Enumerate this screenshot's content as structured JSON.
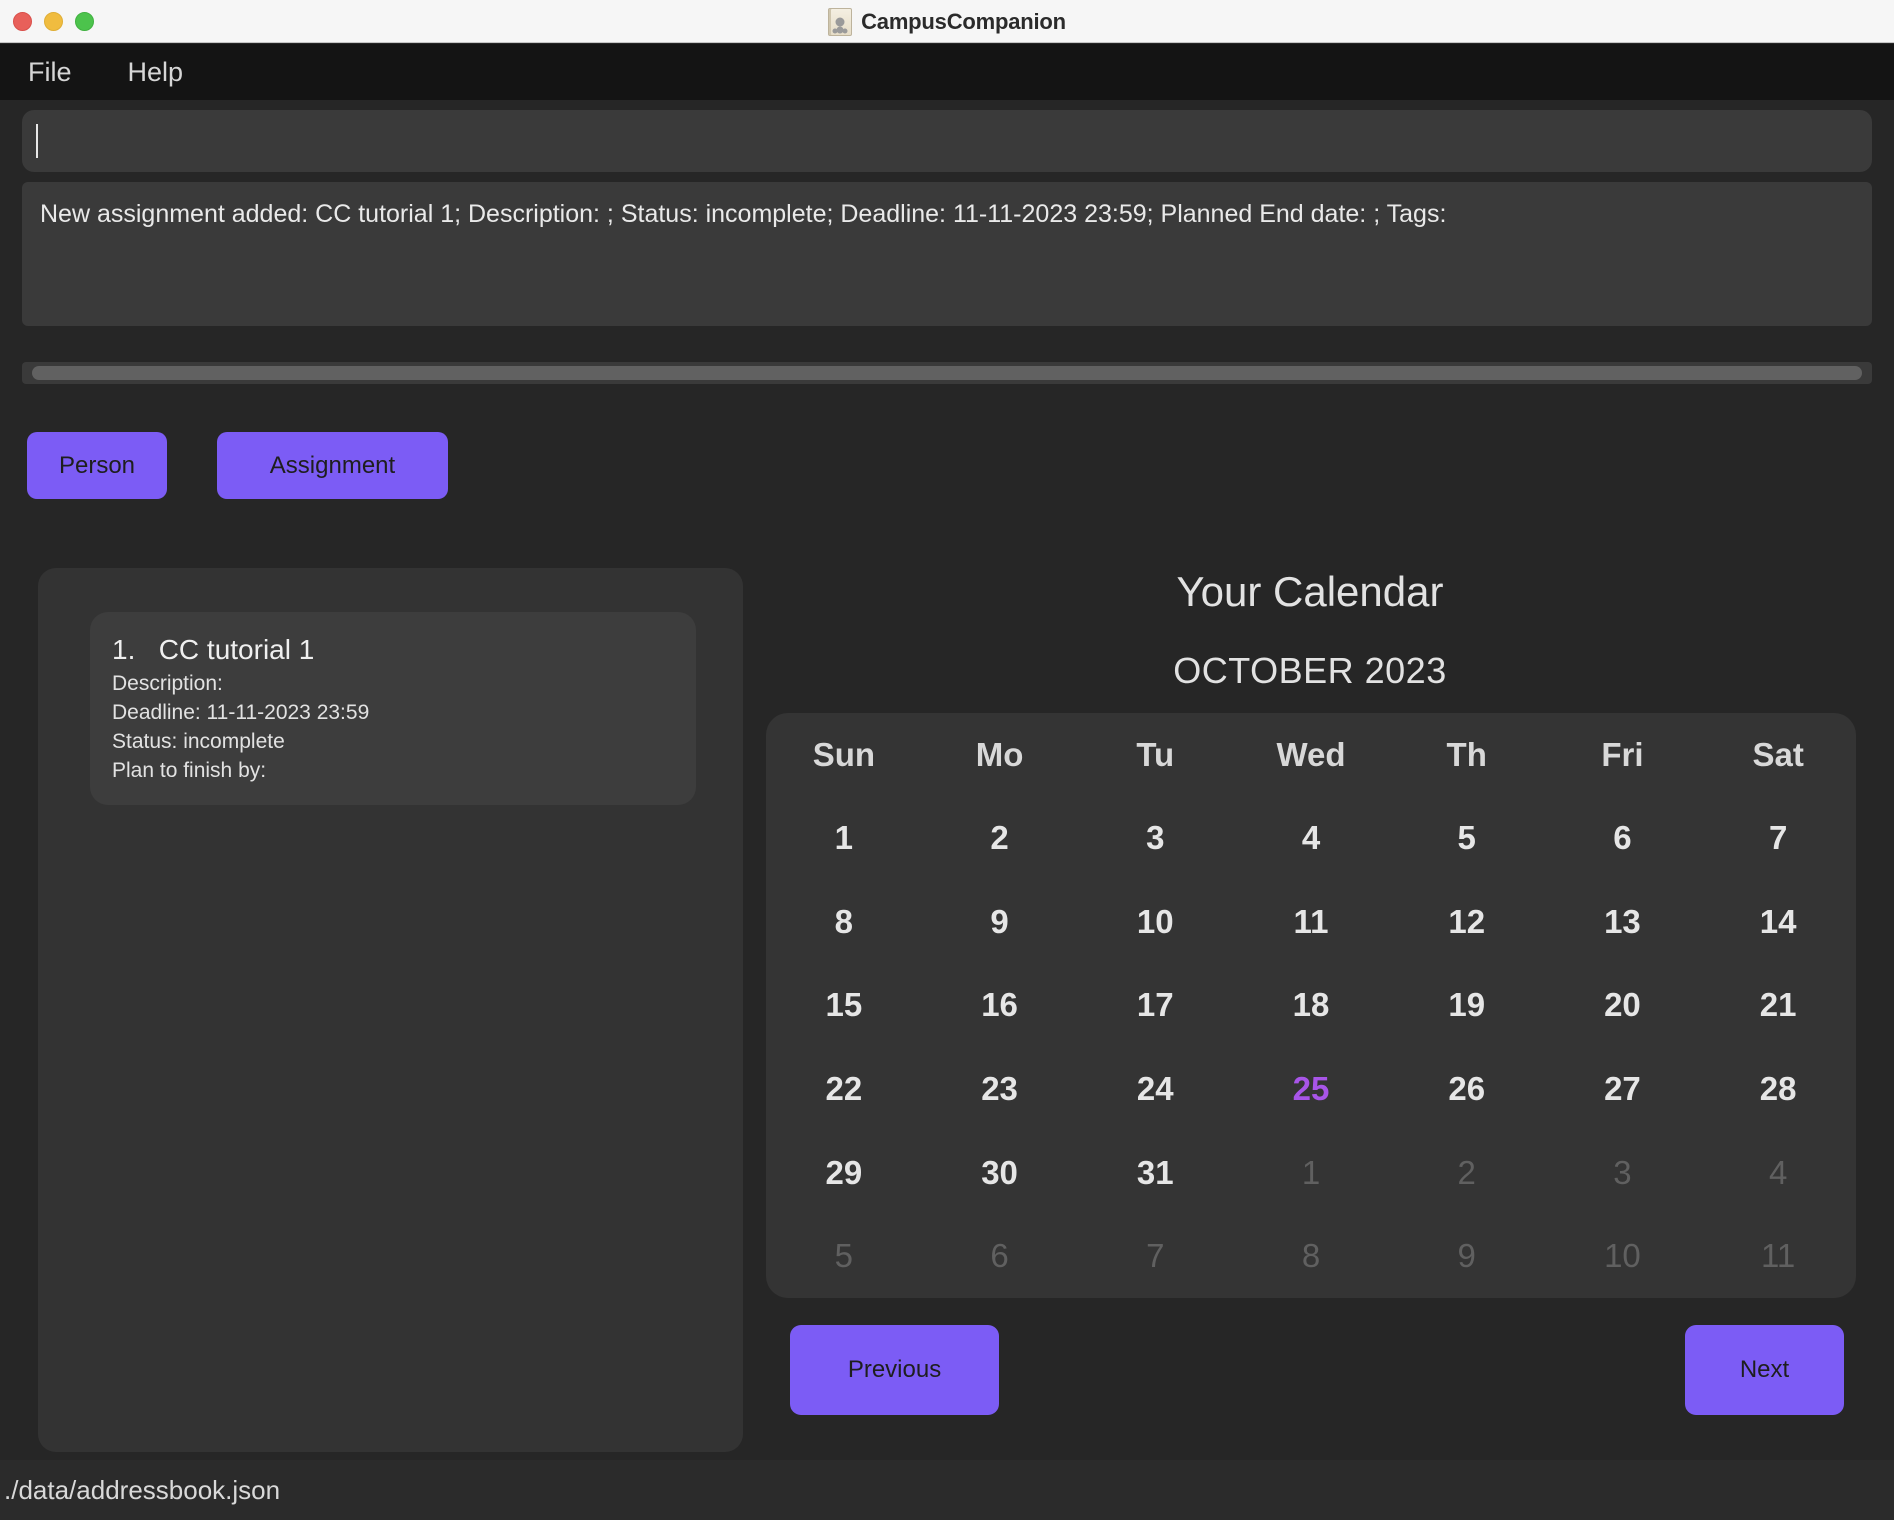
{
  "window": {
    "title": "CampusCompanion",
    "icon": "address-book-icon",
    "traffic_lights": {
      "close_color": "#e8605a",
      "minimize_color": "#f0bc3f",
      "maximize_color": "#4cc34c"
    }
  },
  "menubar": {
    "items": [
      {
        "label": "File"
      },
      {
        "label": "Help"
      }
    ]
  },
  "command_input": {
    "value": "",
    "placeholder": ""
  },
  "result": {
    "text": "New assignment added: CC tutorial 1; Description: ; Status: incomplete; Deadline: 11-11-2023 23:59; Planned End date: ; Tags:"
  },
  "toolbar": {
    "person_label": "Person",
    "assignment_label": "Assignment",
    "accent_color": "#7c5cf5"
  },
  "list_panel": {
    "items": [
      {
        "index": "1.",
        "name": "CC tutorial 1",
        "description_line": "Description:",
        "deadline_line": "Deadline: 11-11-2023 23:59",
        "status_line": "Status: incomplete",
        "plan_line": "Plan to finish by:"
      }
    ]
  },
  "calendar": {
    "heading": "Your Calendar",
    "month_label": "OCTOBER 2023",
    "today_color": "#a855e8",
    "day_headers": [
      "Sun",
      "Mo",
      "Tu",
      "Wed",
      "Th",
      "Fri",
      "Sat"
    ],
    "weeks": [
      [
        {
          "n": "1",
          "muted": false,
          "today": false
        },
        {
          "n": "2",
          "muted": false,
          "today": false
        },
        {
          "n": "3",
          "muted": false,
          "today": false
        },
        {
          "n": "4",
          "muted": false,
          "today": false
        },
        {
          "n": "5",
          "muted": false,
          "today": false
        },
        {
          "n": "6",
          "muted": false,
          "today": false
        },
        {
          "n": "7",
          "muted": false,
          "today": false
        }
      ],
      [
        {
          "n": "8",
          "muted": false,
          "today": false
        },
        {
          "n": "9",
          "muted": false,
          "today": false
        },
        {
          "n": "10",
          "muted": false,
          "today": false
        },
        {
          "n": "11",
          "muted": false,
          "today": false
        },
        {
          "n": "12",
          "muted": false,
          "today": false
        },
        {
          "n": "13",
          "muted": false,
          "today": false
        },
        {
          "n": "14",
          "muted": false,
          "today": false
        }
      ],
      [
        {
          "n": "15",
          "muted": false,
          "today": false
        },
        {
          "n": "16",
          "muted": false,
          "today": false
        },
        {
          "n": "17",
          "muted": false,
          "today": false
        },
        {
          "n": "18",
          "muted": false,
          "today": false
        },
        {
          "n": "19",
          "muted": false,
          "today": false
        },
        {
          "n": "20",
          "muted": false,
          "today": false
        },
        {
          "n": "21",
          "muted": false,
          "today": false
        }
      ],
      [
        {
          "n": "22",
          "muted": false,
          "today": false
        },
        {
          "n": "23",
          "muted": false,
          "today": false
        },
        {
          "n": "24",
          "muted": false,
          "today": false
        },
        {
          "n": "25",
          "muted": false,
          "today": true
        },
        {
          "n": "26",
          "muted": false,
          "today": false
        },
        {
          "n": "27",
          "muted": false,
          "today": false
        },
        {
          "n": "28",
          "muted": false,
          "today": false
        }
      ],
      [
        {
          "n": "29",
          "muted": false,
          "today": false
        },
        {
          "n": "30",
          "muted": false,
          "today": false
        },
        {
          "n": "31",
          "muted": false,
          "today": false
        },
        {
          "n": "1",
          "muted": true,
          "today": false
        },
        {
          "n": "2",
          "muted": true,
          "today": false
        },
        {
          "n": "3",
          "muted": true,
          "today": false
        },
        {
          "n": "4",
          "muted": true,
          "today": false
        }
      ],
      [
        {
          "n": "5",
          "muted": true,
          "today": false
        },
        {
          "n": "6",
          "muted": true,
          "today": false
        },
        {
          "n": "7",
          "muted": true,
          "today": false
        },
        {
          "n": "8",
          "muted": true,
          "today": false
        },
        {
          "n": "9",
          "muted": true,
          "today": false
        },
        {
          "n": "10",
          "muted": true,
          "today": false
        },
        {
          "n": "11",
          "muted": true,
          "today": false
        }
      ]
    ],
    "previous_label": "Previous",
    "next_label": "Next"
  },
  "statusbar": {
    "path": "./data/addressbook.json"
  }
}
